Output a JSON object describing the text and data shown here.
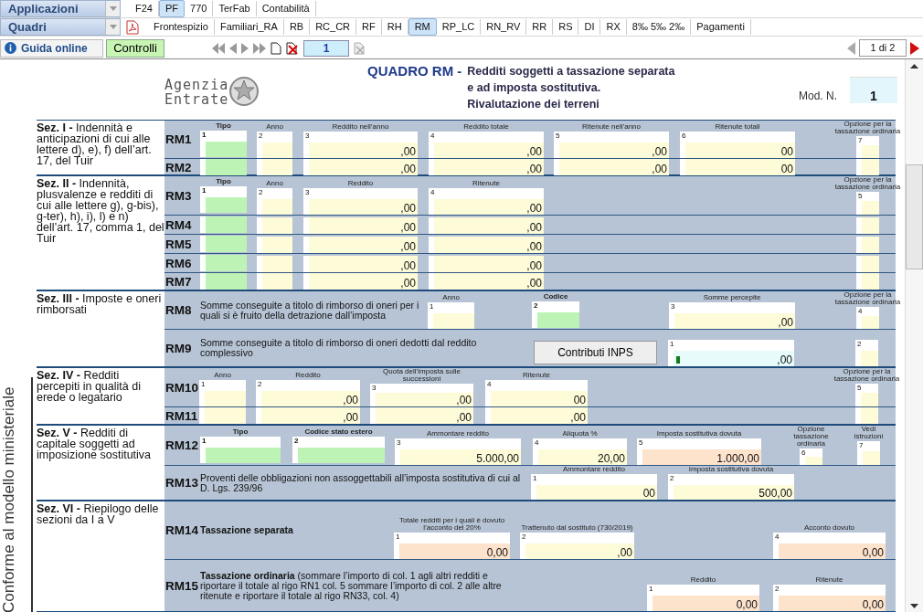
{
  "apps_menu": {
    "label": "Applicazioni"
  },
  "app_tabs": [
    {
      "label": "F24",
      "selected": false
    },
    {
      "label": "PF",
      "selected": true
    },
    {
      "label": "770",
      "selected": false
    },
    {
      "label": "TerFab",
      "selected": false
    },
    {
      "label": "Contabilità",
      "selected": false
    }
  ],
  "quadri_menu": {
    "label": "Quadri"
  },
  "quadri_tabs": [
    {
      "label": "Frontespizio",
      "selected": false
    },
    {
      "label": "Familiari_RA",
      "selected": false
    },
    {
      "label": "RB",
      "selected": false
    },
    {
      "label": "RC_CR",
      "selected": false
    },
    {
      "label": "RF",
      "selected": false
    },
    {
      "label": "RH",
      "selected": false
    },
    {
      "label": "RM",
      "selected": true
    },
    {
      "label": "RP_LC",
      "selected": false
    },
    {
      "label": "RN_RV",
      "selected": false
    },
    {
      "label": "RR",
      "selected": false
    },
    {
      "label": "RS",
      "selected": false
    },
    {
      "label": "DI",
      "selected": false
    },
    {
      "label": "RX",
      "selected": false
    },
    {
      "label": "8‰ 5‰ 2‰",
      "selected": false
    },
    {
      "label": "Pagamenti",
      "selected": false
    }
  ],
  "toolbar": {
    "help_button": "Guida online",
    "check_button": "Controlli",
    "page_field": "1",
    "page_count": "1 di 2"
  },
  "header": {
    "logo_line1": "Agenzia",
    "logo_line2": "Entrate",
    "title": "QUADRO RM -",
    "subtitle": [
      "Redditi soggetti a tassazione separata",
      "e ad imposta sostitutiva.",
      "Rivalutazione dei terreni"
    ],
    "mod_label": "Mod. N.",
    "mod_value": "1"
  },
  "side_note": "Conforme al modello ministeriale",
  "sections": [
    {
      "label": "**Sez. I -** Indennità e anticipazioni di cui alle lettere d), e), f) dell’art. 17, del Tuir",
      "form_lines": [
        {
          "code": "RM1",
          "entries": [
            {
              "kind": "code",
              "header": "Tipo",
              "num": "1"
            },
            {
              "kind": "input",
              "header": "Anno",
              "num": "2"
            },
            {
              "kind": "input",
              "header": "Reddito nell’anno",
              "num": "3",
              "value": ",00"
            },
            {
              "kind": "input",
              "header": "Reddito totale",
              "num": "4",
              "value": ",00"
            },
            {
              "kind": "input",
              "header": "Ritenute nell’anno",
              "num": "5",
              "value": ",00"
            },
            {
              "kind": "input",
              "header": "Ritenute totali",
              "num": "6",
              "value": "00"
            },
            {
              "kind": "input",
              "header": "Opzione per la tassazione ordinaria",
              "num": "7"
            }
          ]
        },
        {
          "code": "RM2",
          "entries": [
            {
              "kind": "code"
            },
            {
              "kind": "input"
            },
            {
              "kind": "input",
              "value": ",00"
            },
            {
              "kind": "input",
              "value": ",00"
            },
            {
              "kind": "input",
              "value": ",00"
            },
            {
              "kind": "input",
              "value": "00"
            },
            {
              "kind": "input"
            }
          ]
        }
      ]
    },
    {
      "label": "**Sez. II -** Indennità, plusvalenze e redditi di cui alle lettere g), g-bis), g-ter), h), i), l) e n) dell’art. 17, comma 1, del Tuir",
      "form_lines": [
        {
          "code": "RM3",
          "entries": [
            {
              "kind": "code",
              "header": "Tipo",
              "num": "1"
            },
            {
              "kind": "input",
              "header": "Anno",
              "num": "2"
            },
            {
              "kind": "input",
              "header": "Reddito",
              "num": "3",
              "value": ",00"
            },
            {
              "kind": "input",
              "header": "Ritenute",
              "num": "4",
              "value": ",00"
            },
            {
              "kind": "input",
              "header": "Opzione per la tassazione ordinaria",
              "num": "5"
            }
          ]
        },
        {
          "code": "RM4",
          "entries": [
            {
              "kind": "code"
            },
            {
              "kind": "input"
            },
            {
              "kind": "input",
              "value": ",00"
            },
            {
              "kind": "input",
              "value": ",00"
            },
            {
              "kind": "input"
            }
          ]
        },
        {
          "code": "RM5",
          "entries": [
            {
              "kind": "code"
            },
            {
              "kind": "input"
            },
            {
              "kind": "input",
              "value": ",00"
            },
            {
              "kind": "input",
              "value": ",00"
            },
            {
              "kind": "input"
            }
          ]
        },
        {
          "code": "RM6",
          "entries": [
            {
              "kind": "code"
            },
            {
              "kind": "input"
            },
            {
              "kind": "input",
              "value": ",00"
            },
            {
              "kind": "input",
              "value": ",00"
            },
            {
              "kind": "input"
            }
          ]
        },
        {
          "code": "RM7",
          "entries": [
            {
              "kind": "code"
            },
            {
              "kind": "input"
            },
            {
              "kind": "input",
              "value": ",00"
            },
            {
              "kind": "input",
              "value": ",00"
            },
            {
              "kind": "input"
            }
          ]
        }
      ]
    },
    {
      "label": "**Sez. III -** Imposte e oneri rimborsati",
      "form_lines": [
        {
          "code": "RM8",
          "entries": [
            {
              "kind": "text",
              "text": "Somme conseguite a titolo di rimborso di oneri per i quali si è fruito della detrazione dall’imposta"
            },
            {
              "kind": "input",
              "header": "Anno",
              "num": "1"
            },
            {
              "kind": "code",
              "header": "Codice",
              "num": "2"
            },
            {
              "kind": "input",
              "header": "Somme percepite",
              "num": "3",
              "value": ",00"
            },
            {
              "kind": "input",
              "header": "Opzione per la tassazione ordinaria",
              "num": "4"
            }
          ]
        },
        {
          "code": "RM9",
          "entries": [
            {
              "kind": "text",
              "text": "Somme conseguite a titolo di rimborso di oneri dedotti dal reddito complessivo"
            },
            {
              "kind": "button",
              "text": "Contributi INPS"
            },
            {
              "kind": "linked",
              "num": "1",
              "value": ",00"
            },
            {
              "kind": "input",
              "num": "2"
            }
          ]
        }
      ]
    },
    {
      "label": "**Sez. IV -** Redditi percepiti in qualità di erede o legatario",
      "form_lines": [
        {
          "code": "RM10",
          "entries": [
            {
              "kind": "input",
              "header": "Anno",
              "num": "1"
            },
            {
              "kind": "input",
              "header": "Reddito",
              "num": "2",
              "value": ",00"
            },
            {
              "kind": "input",
              "header": "Quota dell’imposta sulle successioni",
              "num": "3",
              "value": ",00"
            },
            {
              "kind": "input",
              "header": "Ritenute",
              "num": "4",
              "value": "00"
            },
            {
              "kind": "input",
              "header": "Opzione per la tassazione ordinaria",
              "num": "5"
            }
          ]
        },
        {
          "code": "RM11",
          "entries": [
            {
              "kind": "input"
            },
            {
              "kind": "input",
              "value": ",00"
            },
            {
              "kind": "input",
              "value": ",00"
            },
            {
              "kind": "input",
              "value": ",00"
            },
            {
              "kind": "input"
            }
          ]
        }
      ]
    },
    {
      "label": "**Sez. V -** Redditi di capitale soggetti ad imposizione sostitutiva",
      "form_lines": [
        {
          "code": "RM12",
          "entries": [
            {
              "kind": "code",
              "header": "Tipo",
              "num": "1"
            },
            {
              "kind": "code",
              "header": "Codice stato estero",
              "num": "2"
            },
            {
              "kind": "input",
              "header": "Ammontare reddito",
              "num": "3",
              "value": "5.000,00"
            },
            {
              "kind": "input",
              "header": "Aliquota %",
              "num": "4",
              "value": "20,00"
            },
            {
              "kind": "computed",
              "header": "Imposta sostitutiva dovuta",
              "num": "5",
              "value": "1.000,00"
            },
            {
              "kind": "input",
              "header": "Opzione tassazione ordinaria",
              "num": "6"
            },
            {
              "kind": "input",
              "header": "Vedi istruzioni",
              "num": "7"
            }
          ]
        },
        {
          "code": "RM13",
          "entries": [
            {
              "kind": "text",
              "text": "Proventi delle obbligazioni non assoggettabili all’imposta sostitutiva di cui al D. Lgs. 239/96"
            },
            {
              "kind": "input",
              "header": "Ammontare reddito",
              "num": "1",
              "value": "00"
            },
            {
              "kind": "input",
              "header": "Imposta sostitutiva dovuta",
              "num": "2",
              "value": "500,00"
            }
          ]
        }
      ]
    },
    {
      "label": "**Sez. VI -** Riepilogo delle sezioni da I a V",
      "form_lines": [
        {
          "code": "RM14",
          "entries": [
            {
              "kind": "heading",
              "text": "Tassazione separata"
            },
            {
              "kind": "computed",
              "header": "Totale redditi per i quali è dovuto l’acconto del 20%",
              "num": "1",
              "value": "0,00"
            },
            {
              "kind": "input",
              "header": "Trattenuto dal sostituto (730/2019)",
              "num": "2",
              "value": ",00"
            },
            {
              "kind": "computed",
              "header": "Acconto dovuto",
              "num": "4",
              "value": "0,00"
            }
          ]
        },
        {
          "code": "RM15",
          "entries": [
            {
              "kind": "text",
              "text": "**Tassazione ordinaria** (sommare l’importo di col. 1 agli altri redditi e riportare il totale al rigo RN1 col. 5 sommare l’importo di col. 2 alle altre ritenute e riportare il totale al rigo RN33, col. 4)"
            },
            {
              "kind": "computed",
              "header": "Reddito",
              "num": "1",
              "value": "0,00"
            },
            {
              "kind": "computed",
              "header": "Ritenute",
              "num": "2",
              "value": "0,00"
            }
          ]
        }
      ]
    }
  ]
}
